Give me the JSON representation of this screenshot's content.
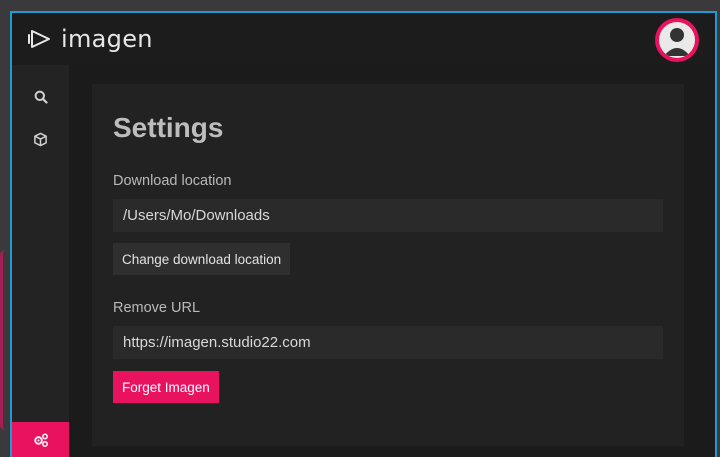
{
  "app": {
    "name": "imagen"
  },
  "sidebar": {
    "items": [
      {
        "icon": "search-icon",
        "active": false
      },
      {
        "icon": "cube-icon",
        "active": false
      },
      {
        "icon": "settings-cogs-icon",
        "active": true
      }
    ]
  },
  "settings": {
    "title": "Settings",
    "download": {
      "label": "Download location",
      "value": "/Users/Mo/Downloads",
      "button_label": "Change download location"
    },
    "remove": {
      "label": "Remove URL",
      "value": "https://imagen.studio22.com",
      "button_label": "Forget Imagen"
    }
  },
  "colors": {
    "accent": "#e8125f",
    "window_border": "#1e9bd7",
    "background": "#1a1a1a"
  }
}
